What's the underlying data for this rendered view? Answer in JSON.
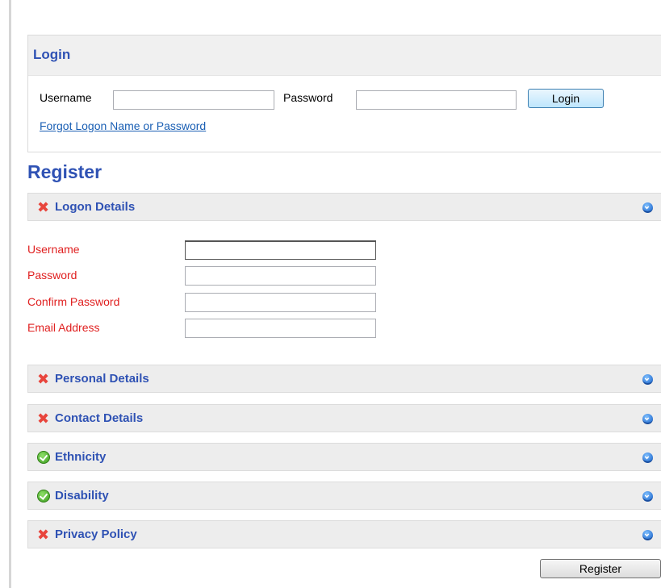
{
  "login": {
    "title": "Login",
    "username_label": "Username",
    "username_value": "",
    "password_label": "Password",
    "password_value": "",
    "login_button": "Login",
    "forgot_link": "Forgot Logon Name or Password"
  },
  "register": {
    "title": "Register",
    "logon_section": {
      "label": "Logon Details",
      "status_icon": "x-icon",
      "fields": [
        {
          "label": "Username",
          "value": ""
        },
        {
          "label": "Password",
          "value": ""
        },
        {
          "label": "Confirm Password",
          "value": ""
        },
        {
          "label": "Email Address",
          "value": ""
        }
      ]
    },
    "sections": [
      {
        "label": "Personal Details",
        "status_icon": "x-icon"
      },
      {
        "label": "Contact Details",
        "status_icon": "x-icon"
      },
      {
        "label": "Ethnicity",
        "status_icon": "check-icon"
      },
      {
        "label": "Disability",
        "status_icon": "check-icon"
      },
      {
        "label": "Privacy Policy",
        "status_icon": "x-icon"
      }
    ],
    "register_button": "Register"
  },
  "colors": {
    "heading_blue": "#2f52b4",
    "required_red": "#e02020",
    "bar_background": "#ededed",
    "link_blue": "#1a5fb4"
  }
}
